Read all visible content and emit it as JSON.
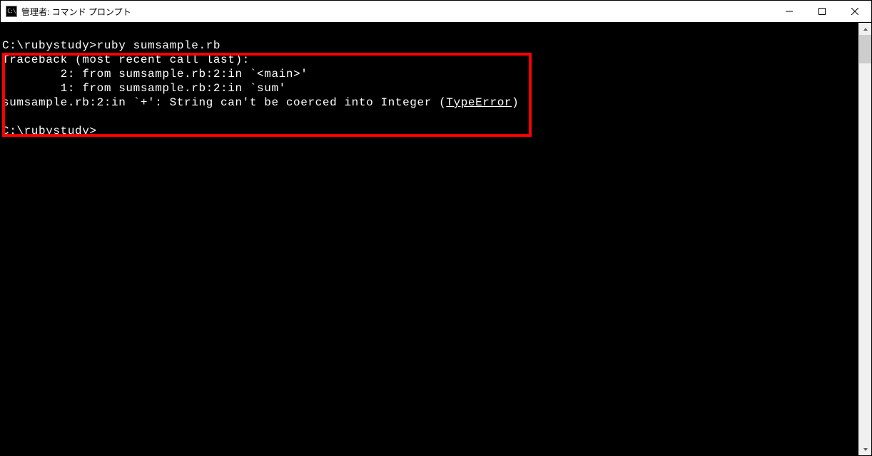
{
  "window": {
    "title": "管理者: コマンド プロンプト",
    "icon_label": "C:\\"
  },
  "terminal": {
    "blank": " ",
    "cmd_line": "C:\\rubystudy>ruby sumsample.rb",
    "trace_header": "Traceback (most recent call last):",
    "trace_2": "        2: from sumsample.rb:2:in `<main>'",
    "trace_1": "        1: from sumsample.rb:2:in `sum'",
    "error_pre": "sumsample.rb:2:in `+': String can't be coerced into Integer (",
    "error_type": "TypeError",
    "error_post": ")",
    "prompt_line": "C:\\rubystudy>"
  }
}
